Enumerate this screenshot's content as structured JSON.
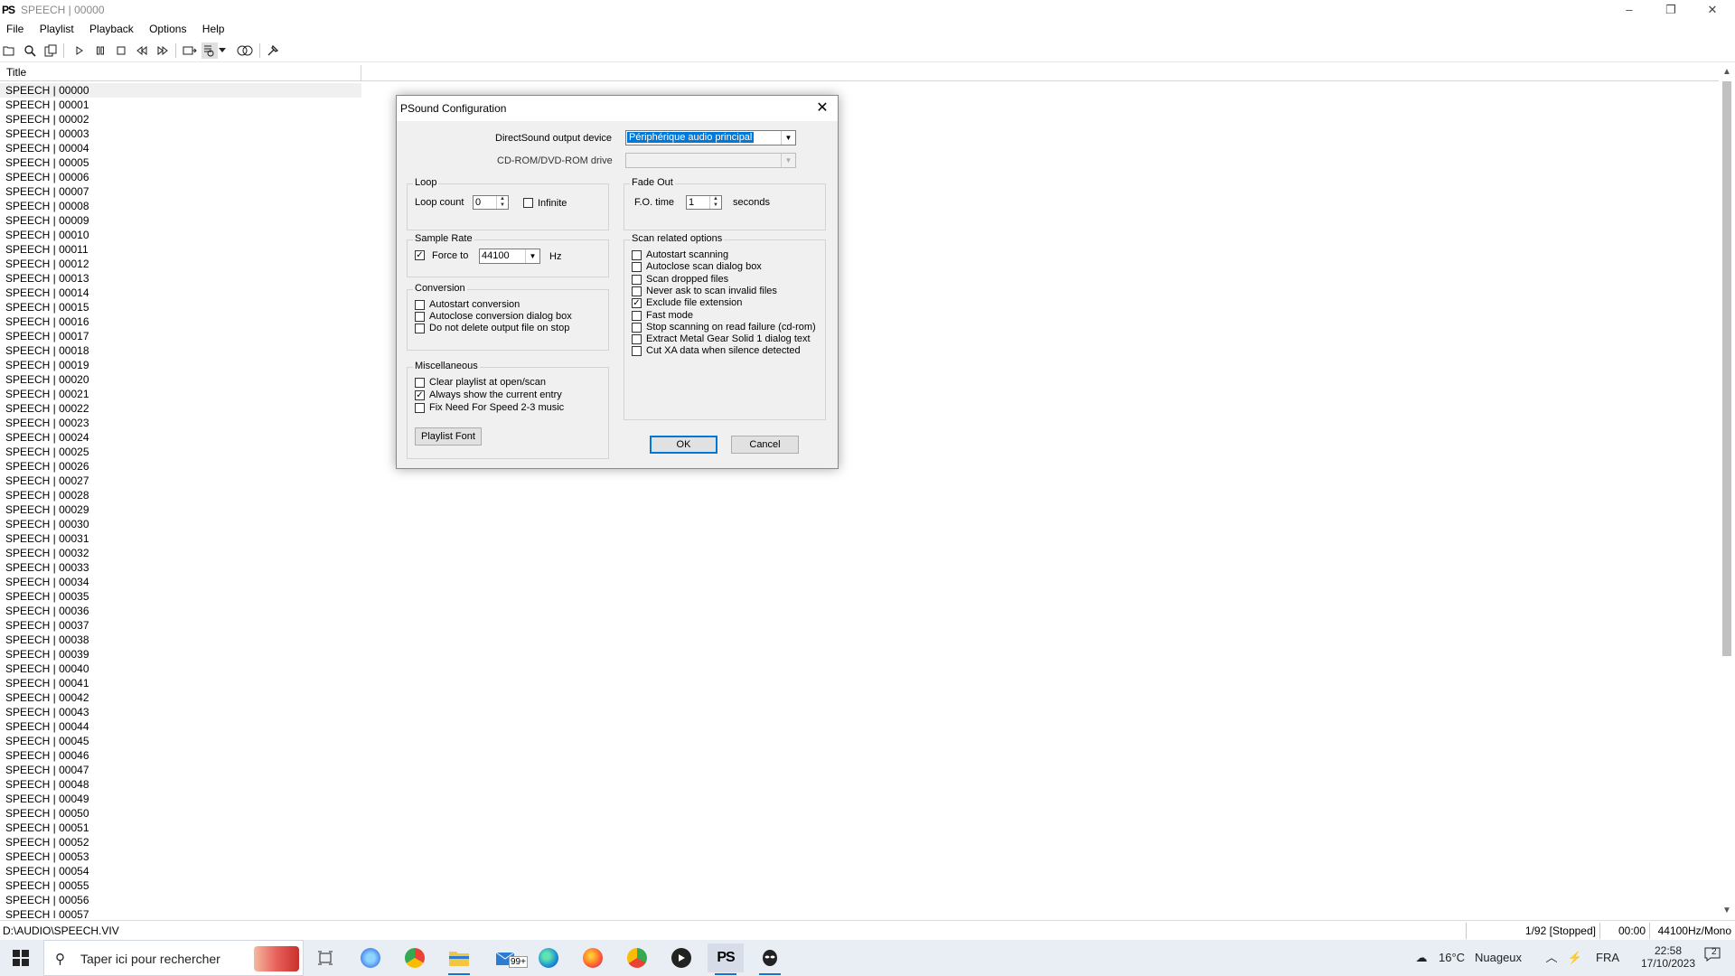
{
  "window": {
    "app_icon": "PS",
    "title": "SPEECH | 00000",
    "controls": [
      "–",
      "❐",
      "✕"
    ]
  },
  "menu": [
    "File",
    "Playlist",
    "Playback",
    "Options",
    "Help"
  ],
  "toolbar_icons": [
    "open-icon",
    "search-icon",
    "copy-icon",
    "play-icon",
    "pause-icon",
    "stop-icon",
    "prev-icon",
    "next-icon",
    "loop-icon",
    "scan-icon",
    "convert-icon",
    "settings-tool-icon"
  ],
  "playlist": {
    "column_title": "Title",
    "rows": [
      "SPEECH | 00000",
      "SPEECH | 00001",
      "SPEECH | 00002",
      "SPEECH | 00003",
      "SPEECH | 00004",
      "SPEECH | 00005",
      "SPEECH | 00006",
      "SPEECH | 00007",
      "SPEECH | 00008",
      "SPEECH | 00009",
      "SPEECH | 00010",
      "SPEECH | 00011",
      "SPEECH | 00012",
      "SPEECH | 00013",
      "SPEECH | 00014",
      "SPEECH | 00015",
      "SPEECH | 00016",
      "SPEECH | 00017",
      "SPEECH | 00018",
      "SPEECH | 00019",
      "SPEECH | 00020",
      "SPEECH | 00021",
      "SPEECH | 00022",
      "SPEECH | 00023",
      "SPEECH | 00024",
      "SPEECH | 00025",
      "SPEECH | 00026",
      "SPEECH | 00027",
      "SPEECH | 00028",
      "SPEECH | 00029",
      "SPEECH | 00030",
      "SPEECH | 00031",
      "SPEECH | 00032",
      "SPEECH | 00033",
      "SPEECH | 00034",
      "SPEECH | 00035",
      "SPEECH | 00036",
      "SPEECH | 00037",
      "SPEECH | 00038",
      "SPEECH | 00039",
      "SPEECH | 00040",
      "SPEECH | 00041",
      "SPEECH | 00042",
      "SPEECH | 00043",
      "SPEECH | 00044",
      "SPEECH | 00045",
      "SPEECH | 00046",
      "SPEECH | 00047",
      "SPEECH | 00048",
      "SPEECH | 00049",
      "SPEECH | 00050",
      "SPEECH | 00051",
      "SPEECH | 00052",
      "SPEECH | 00053",
      "SPEECH | 00054",
      "SPEECH | 00055",
      "SPEECH | 00056",
      "SPEECH | 00057"
    ],
    "selected_index": 0
  },
  "status": {
    "path": "D:\\AUDIO\\SPEECH.VIV",
    "track": "1/92 [Stopped]",
    "time": "00:00",
    "format": "44100Hz/Mono"
  },
  "dialog": {
    "title": "PSound Configuration",
    "output_device_label": "DirectSound output device",
    "output_device_value": "Périphérique audio principal",
    "cdrom_label": "CD-ROM/DVD-ROM drive",
    "cdrom_value": "",
    "loop": {
      "title": "Loop",
      "count_label": "Loop count",
      "count_value": "0",
      "infinite_label": "Infinite",
      "infinite_checked": false
    },
    "fade_out": {
      "title": "Fade Out",
      "time_label": "F.O. time",
      "time_value": "1",
      "unit": "seconds"
    },
    "sample_rate": {
      "title": "Sample Rate",
      "force_label": "Force to",
      "force_checked": true,
      "rate_value": "44100",
      "unit": "Hz"
    },
    "conversion": {
      "title": "Conversion",
      "options": [
        {
          "label": "Autostart conversion",
          "checked": false
        },
        {
          "label": "Autoclose conversion dialog box",
          "checked": false
        },
        {
          "label": "Do not delete output file on stop",
          "checked": false
        }
      ]
    },
    "misc": {
      "title": "Miscellaneous",
      "options": [
        {
          "label": "Clear playlist at open/scan",
          "checked": false
        },
        {
          "label": "Always show the current entry",
          "checked": true
        },
        {
          "label": "Fix Need For Speed 2-3 music",
          "checked": false
        }
      ],
      "font_button": "Playlist Font"
    },
    "scan": {
      "title": "Scan related options",
      "options": [
        {
          "label": "Autostart scanning",
          "checked": false
        },
        {
          "label": "Autoclose scan dialog box",
          "checked": false
        },
        {
          "label": "Scan dropped files",
          "checked": false
        },
        {
          "label": "Never ask to scan invalid files",
          "checked": false
        },
        {
          "label": "Exclude file extension",
          "checked": true
        },
        {
          "label": "Fast mode",
          "checked": false
        },
        {
          "label": "Stop scanning on read failure (cd-rom)",
          "checked": false
        },
        {
          "label": "Extract Metal Gear Solid 1 dialog text",
          "checked": false
        },
        {
          "label": "Cut XA data when silence detected",
          "checked": false
        }
      ]
    },
    "ok_label": "OK",
    "cancel_label": "Cancel"
  },
  "taskbar": {
    "search_placeholder": "Taper ici pour rechercher",
    "mail_badge": "99+",
    "weather_temp": "16°C",
    "weather_text": "Nuageux",
    "language": "FRA",
    "clock_time": "22:58",
    "clock_date": "17/10/2023",
    "notification_count": "2"
  }
}
